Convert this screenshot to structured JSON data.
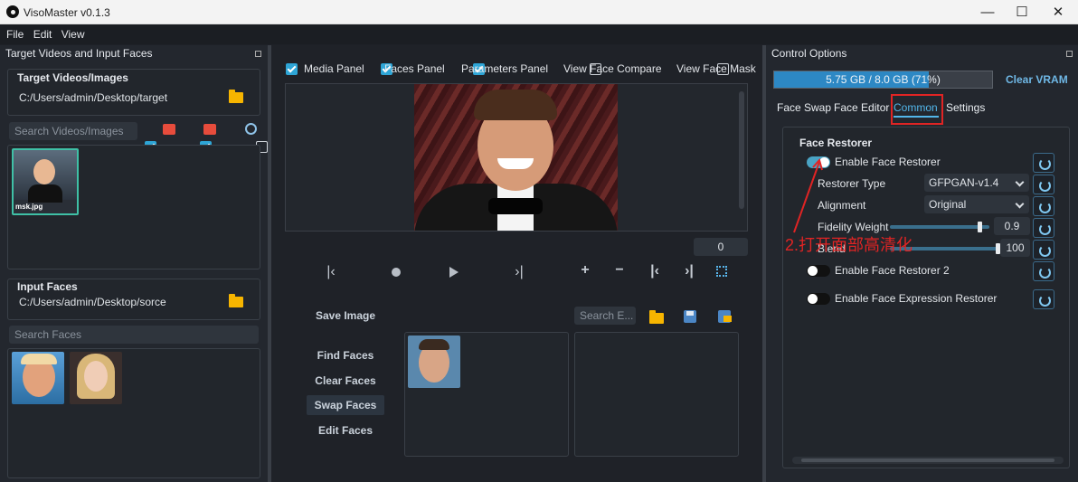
{
  "window": {
    "title": "VisoMaster v0.1.3",
    "min": "—",
    "max": "☐",
    "close": "✕"
  },
  "menu": [
    "File",
    "Edit",
    "View"
  ],
  "left": {
    "dock_title": "Target Videos and Input Faces",
    "target_label": "Target Videos/Images",
    "target_path": "C:/Users/admin/Desktop/target",
    "search_videos_placeholder": "Search Videos/Images",
    "target_file_name": "msk.jpg",
    "input_faces_label": "Input Faces",
    "input_path": "C:/Users/admin/Desktop/sorce",
    "search_faces_placeholder": "Search Faces"
  },
  "center": {
    "checkboxes": [
      {
        "label": "Media Panel",
        "checked": true
      },
      {
        "label": "Faces Panel",
        "checked": true
      },
      {
        "label": "Parameters Panel",
        "checked": true
      },
      {
        "label": "View Face Compare",
        "checked": false
      },
      {
        "label": "View Face Mask",
        "checked": false
      }
    ],
    "frame_number": "0",
    "save_image": "Save Image",
    "search_embeddings_placeholder": "Search E...",
    "find_faces": "Find Faces",
    "clear_faces": "Clear Faces",
    "swap_faces": "Swap Faces",
    "edit_faces": "Edit Faces"
  },
  "right": {
    "dock_title": "Control Options",
    "vram_text": "5.75 GB / 8.0 GB (71%)",
    "vram_fraction": 0.71,
    "clear_vram": "Clear VRAM",
    "tabs": [
      "Face Swap",
      "Face Editor",
      "Common",
      "Settings"
    ],
    "active_tab": "Common",
    "section_title": "Face Restorer",
    "enable_restorer": "Enable Face Restorer",
    "restorer_type_label": "Restorer Type",
    "restorer_type_value": "GFPGAN-v1.4",
    "alignment_label": "Alignment",
    "alignment_value": "Original",
    "fidelity_label": "Fidelity Weight",
    "fidelity_value": "0.9",
    "blend_label": "Blend",
    "blend_value": "100",
    "enable_restorer2": "Enable Face Restorer 2",
    "enable_expression": "Enable Face Expression Restorer",
    "annotation": "2.打开面部高清化"
  },
  "colors": {
    "accent": "#2ea5d6",
    "annotation_red": "#e02424",
    "vram_bar": "#2d88c4"
  }
}
